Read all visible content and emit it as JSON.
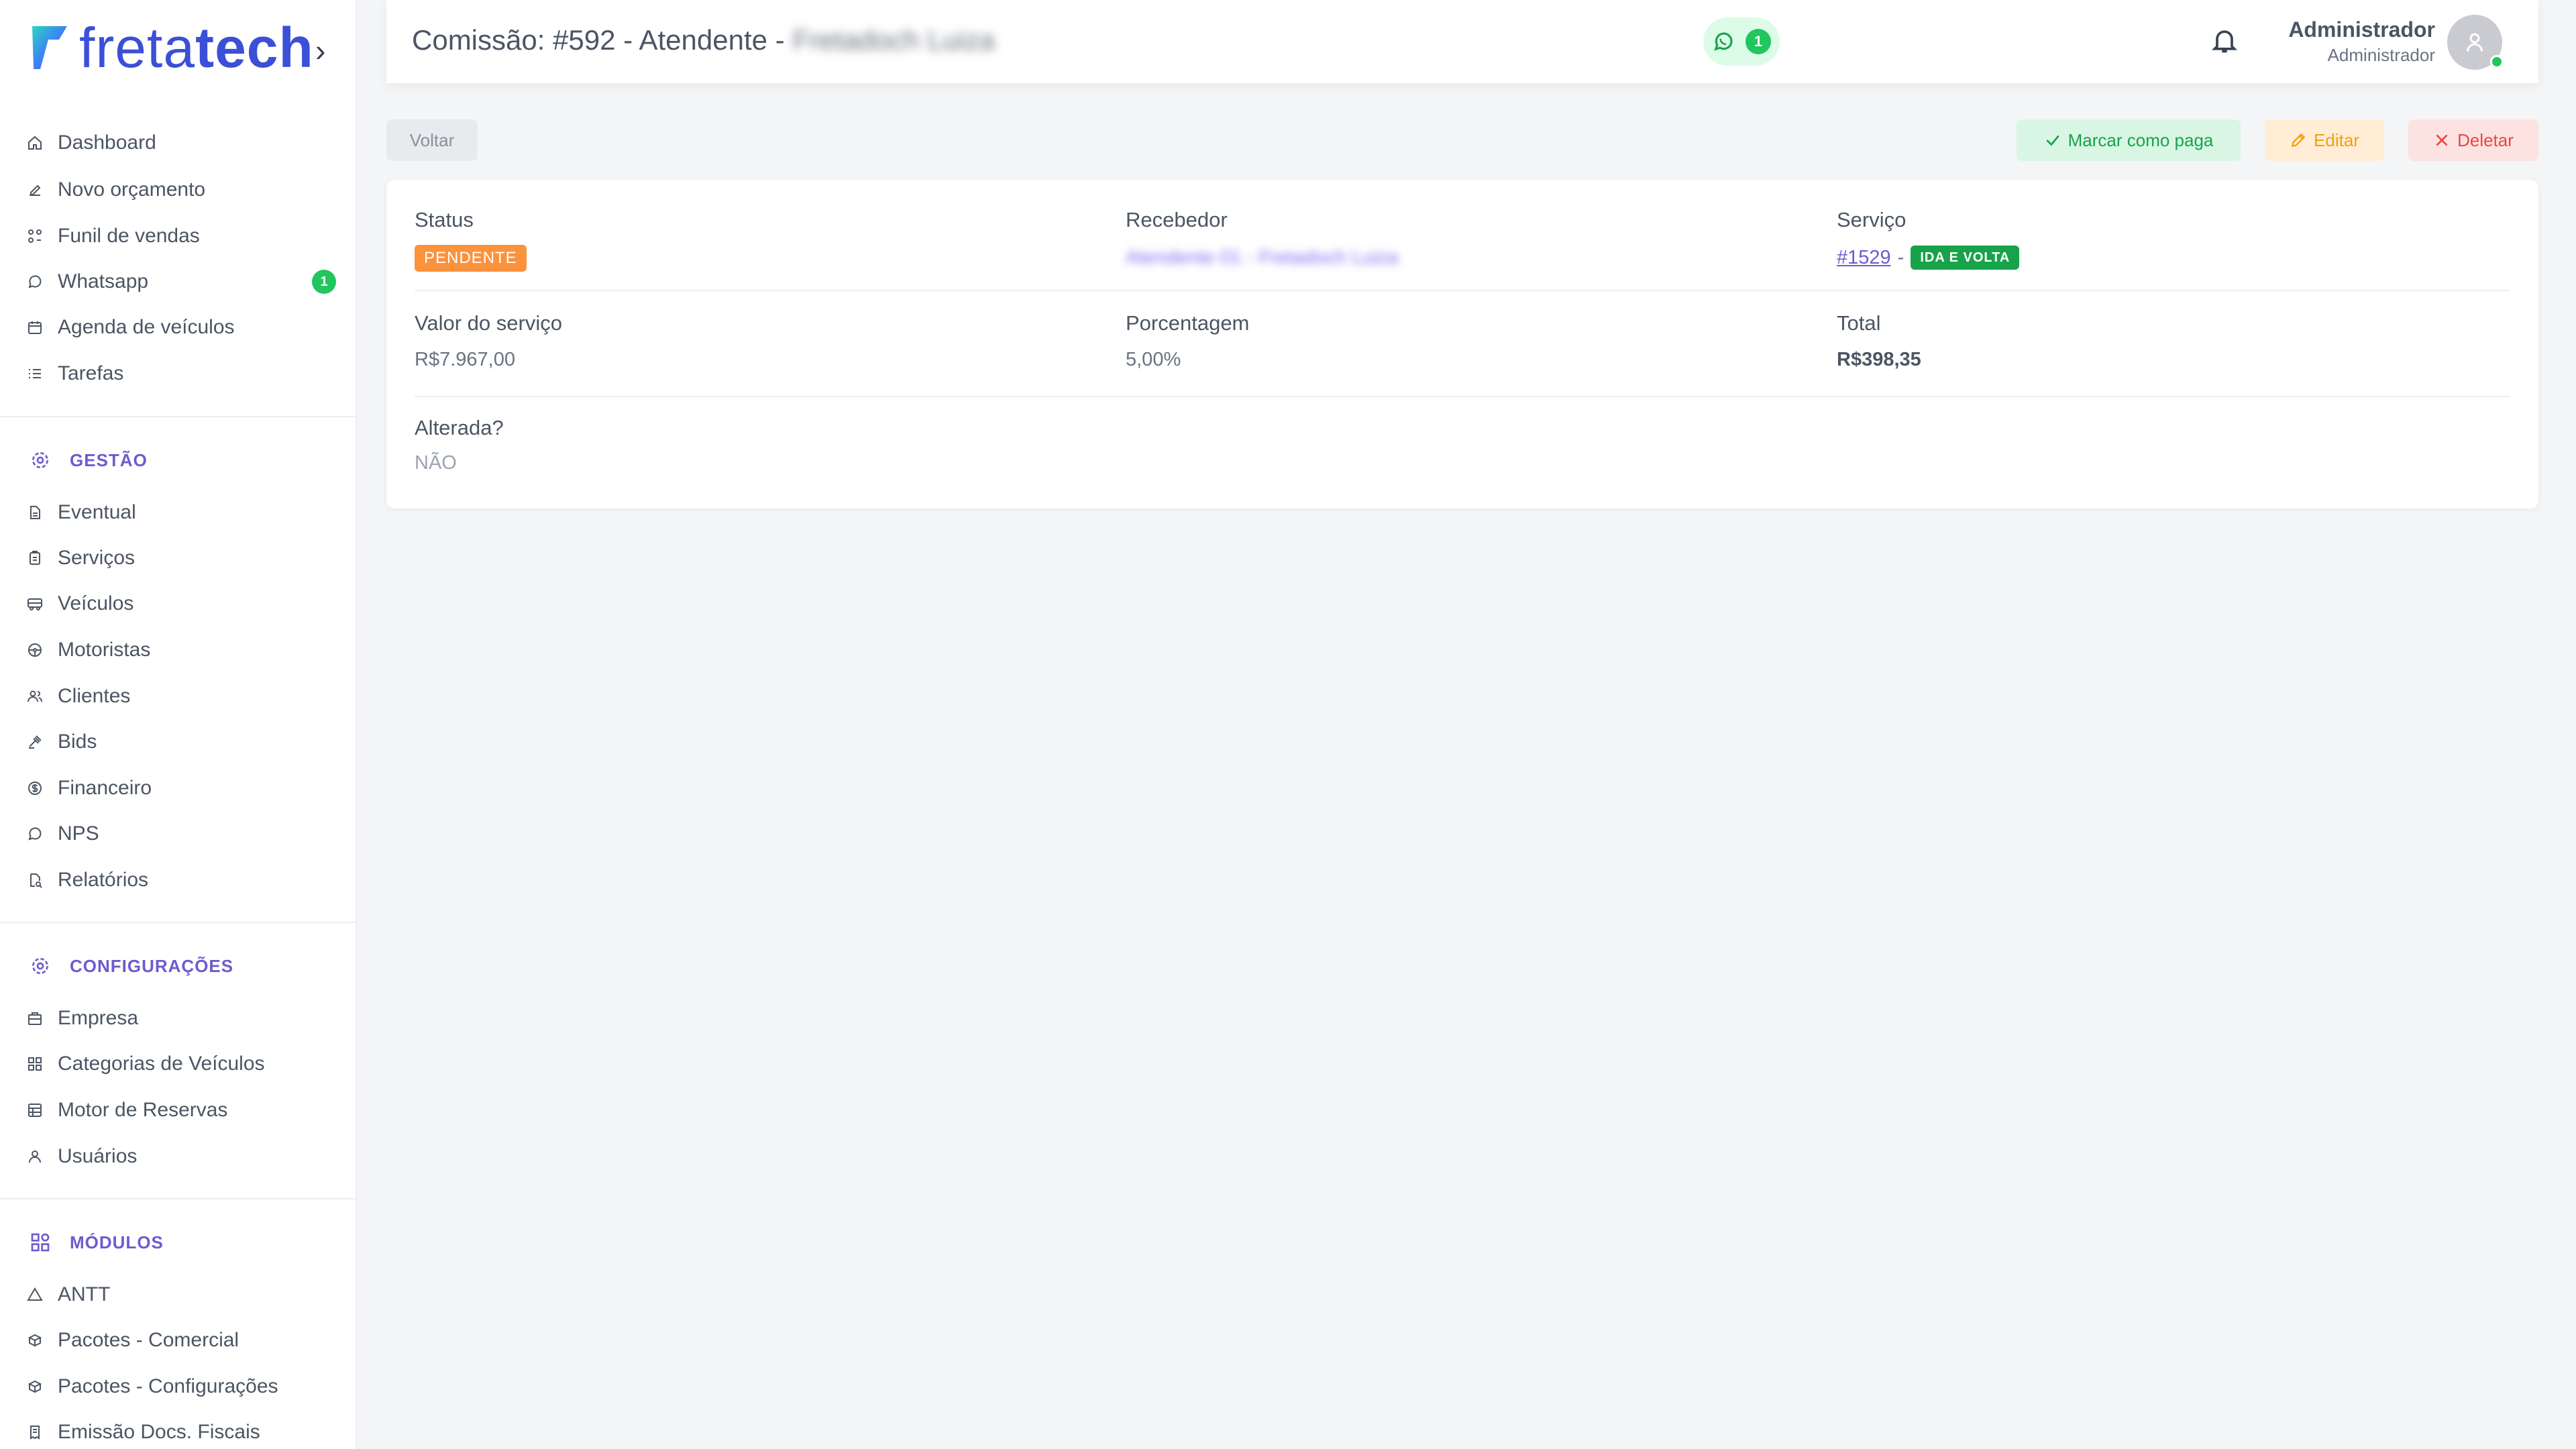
{
  "brand": {
    "name_part1": "freta",
    "name_part2": "tech",
    "accent": "#3b4fd8",
    "purple": "#6d5bd0",
    "green": "#22c55e"
  },
  "sidebar": {
    "main_items": [
      {
        "label": "Dashboard",
        "icon": "home-icon"
      },
      {
        "label": "Novo orçamento",
        "icon": "edit-icon"
      },
      {
        "label": "Funil de vendas",
        "icon": "funnel-icon"
      },
      {
        "label": "Whatsapp",
        "icon": "whatsapp-icon",
        "badge": "1"
      },
      {
        "label": "Agenda de veículos",
        "icon": "calendar-icon"
      },
      {
        "label": "Tarefas",
        "icon": "list-icon"
      }
    ],
    "gestao": {
      "title": "GESTÃO",
      "items": [
        {
          "label": "Eventual",
          "icon": "document-icon"
        },
        {
          "label": "Serviços",
          "icon": "clipboard-icon"
        },
        {
          "label": "Veículos",
          "icon": "bus-icon"
        },
        {
          "label": "Motoristas",
          "icon": "steering-wheel-icon"
        },
        {
          "label": "Clientes",
          "icon": "users-icon"
        },
        {
          "label": "Bids",
          "icon": "gavel-icon"
        },
        {
          "label": "Financeiro",
          "icon": "dollar-icon"
        },
        {
          "label": "NPS",
          "icon": "chat-icon"
        },
        {
          "label": "Relatórios",
          "icon": "report-icon"
        }
      ]
    },
    "config": {
      "title": "CONFIGURAÇÕES",
      "items": [
        {
          "label": "Empresa",
          "icon": "building-icon"
        },
        {
          "label": "Categorias de Veículos",
          "icon": "grid-icon"
        },
        {
          "label": "Motor de Reservas",
          "icon": "table-icon"
        },
        {
          "label": "Usuários",
          "icon": "user-icon"
        }
      ]
    },
    "modulos": {
      "title": "MÓDULOS",
      "items": [
        {
          "label": "ANTT",
          "icon": "triangle-icon"
        },
        {
          "label": "Pacotes - Comercial",
          "icon": "package-icon"
        },
        {
          "label": "Pacotes - Configurações",
          "icon": "package-settings-icon"
        },
        {
          "label": "Emissão Docs. Fiscais",
          "icon": "invoice-icon"
        }
      ]
    }
  },
  "header": {
    "title": "Comissão: #592 - Atendente -",
    "title_blurred": "Fretadoch Luiza",
    "whatsapp_count": "1",
    "user_name": "Administrador",
    "user_role": "Administrador"
  },
  "actions": {
    "back": "Voltar",
    "mark_paid": "Marcar como paga",
    "edit": "Editar",
    "delete": "Deletar"
  },
  "details": {
    "status_label": "Status",
    "status_value": "PENDENTE",
    "receiver_label": "Recebedor",
    "receiver_value": "Atendente 01 - Fretadoch Luiza",
    "service_label": "Serviço",
    "service_link": "#1529",
    "service_sep": "-",
    "service_badge": "IDA E VOLTA",
    "service_value_label": "Valor do serviço",
    "service_value": "R$7.967,00",
    "percent_label": "Porcentagem",
    "percent_value": "5,00%",
    "total_label": "Total",
    "total_value": "R$398,35",
    "changed_label": "Alterada?",
    "changed_value": "NÃO"
  }
}
